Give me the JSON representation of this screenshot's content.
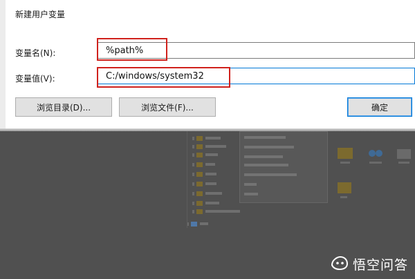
{
  "dialog": {
    "title": "新建用户变量",
    "name_label": "变量名(N):",
    "value_label": "变量值(V):",
    "name_value": "%path%",
    "value_value": "C:/windows/system32",
    "browse_dir_button": "浏览目录(D)...",
    "browse_file_button": "浏览文件(F)...",
    "ok_button": "确定"
  },
  "watermark": {
    "text": "悟空问答"
  },
  "colors": {
    "highlight": "#d0211c",
    "focus_border": "#0078d7",
    "dim_background": "#505050"
  }
}
